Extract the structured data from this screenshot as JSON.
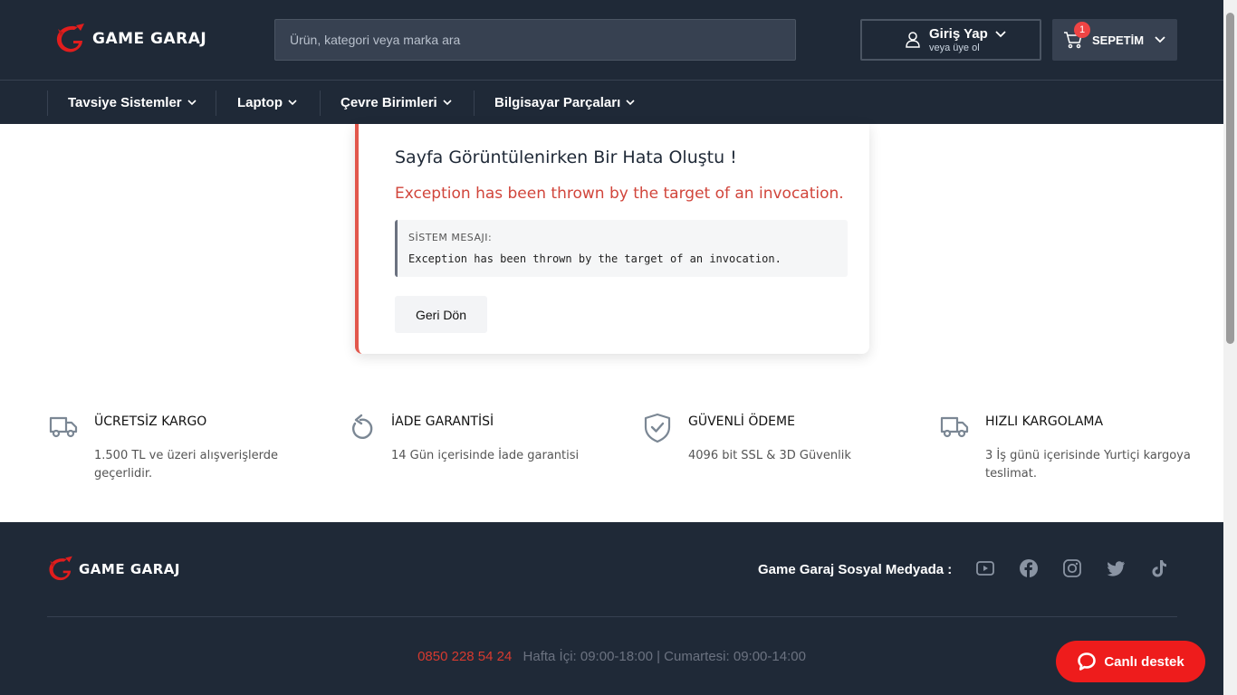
{
  "header": {
    "logo_text": "GAME GARAJ",
    "search_placeholder": "Ürün, kategori veya marka ara",
    "login_title": "Giriş Yap",
    "login_subtitle": "veya üye ol",
    "cart_label": "SEPETİM",
    "cart_count": "1"
  },
  "nav": {
    "items": [
      {
        "label": "Tavsiye Sistemler"
      },
      {
        "label": "Laptop"
      },
      {
        "label": "Çevre Birimleri"
      },
      {
        "label": "Bilgisayar Parçaları"
      }
    ]
  },
  "error": {
    "title": "Sayfa Görüntülenirken Bir Hata Oluştu !",
    "exception": "Exception has been thrown by the target of an invocation.",
    "system_label": "SİSTEM MESAJI:",
    "system_message": "Exception has been thrown by the target of an invocation.",
    "back_button": "Geri Dön"
  },
  "features": [
    {
      "icon": "truck-icon",
      "title": "ÜCRETSİZ KARGO",
      "desc": "1.500 TL ve üzeri alışverişlerde geçerlidir."
    },
    {
      "icon": "return-icon",
      "title": "İADE GARANTİSİ",
      "desc": "14 Gün içerisinde İade garantisi"
    },
    {
      "icon": "shield-check-icon",
      "title": "GÜVENLİ ÖDEME",
      "desc": "4096 bit SSL & 3D Güvenlik"
    },
    {
      "icon": "truck-icon",
      "title": "HIZLI KARGOLAMA",
      "desc": "3 İş günü içerisinde Yurtiçi kargoya teslimat."
    }
  ],
  "footer": {
    "logo_text": "GAME GARAJ",
    "social_title": "Game Garaj Sosyal Medyada :",
    "social": [
      "youtube-icon",
      "facebook-icon",
      "instagram-icon",
      "twitter-icon",
      "tiktok-icon"
    ],
    "phone": "0850 228 54 24",
    "hours": "Hafta İçi: 09:00-18:00 | Cumartesi: 09:00-14:00"
  },
  "chat": {
    "label": "Canlı destek"
  },
  "colors": {
    "header_bg": "#1f2937",
    "accent_red": "#e2574c",
    "chat_red": "#ee1c1c"
  }
}
